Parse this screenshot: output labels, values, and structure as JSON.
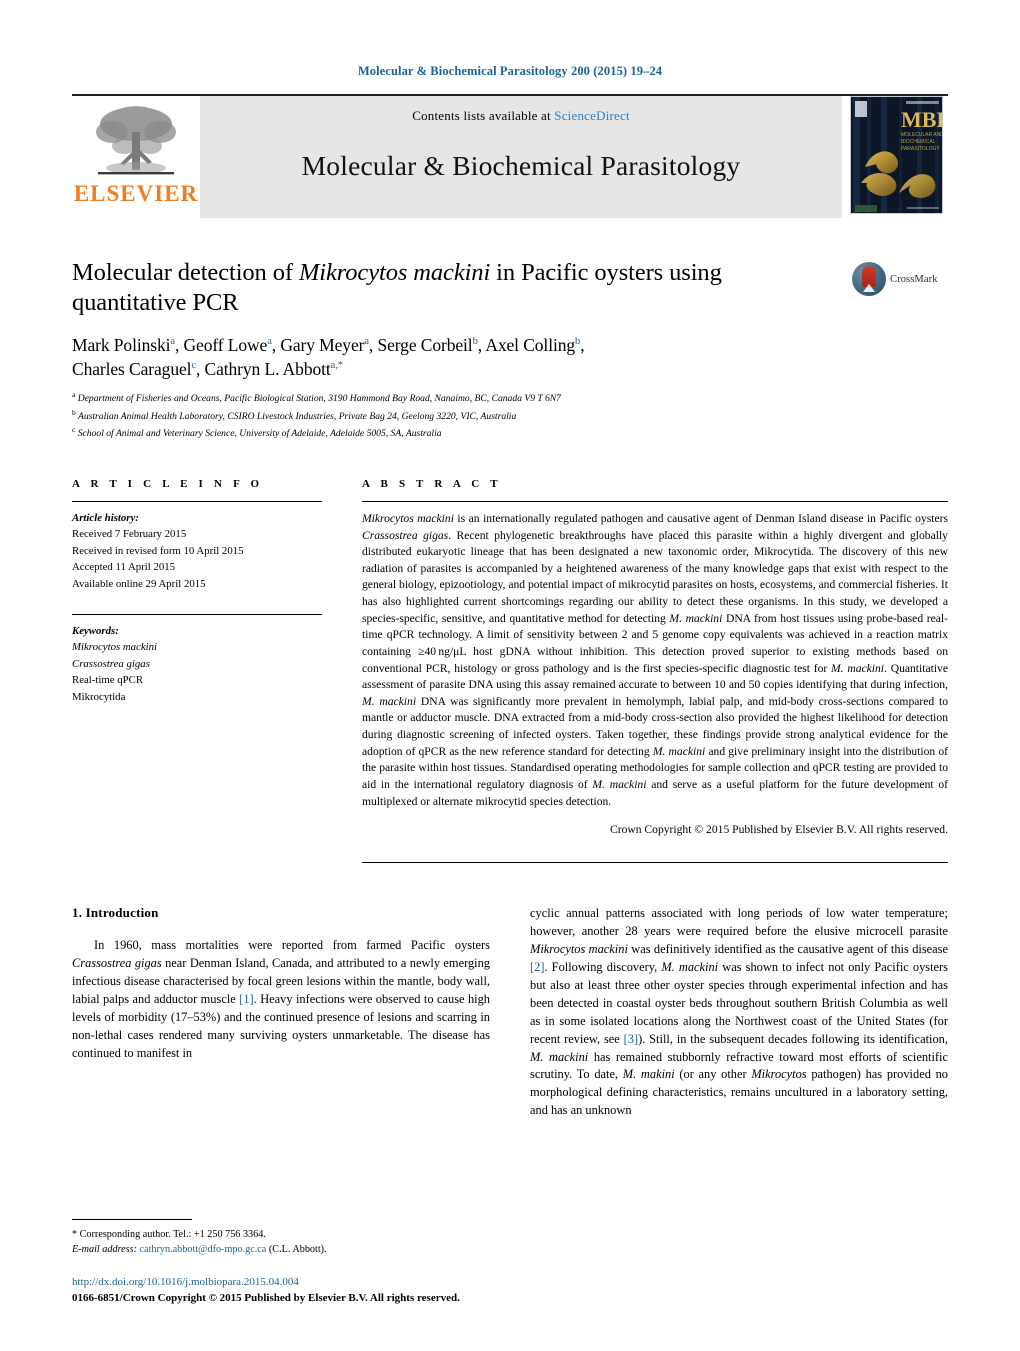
{
  "running_head": "Molecular & Biochemical Parasitology 200 (2015) 19–24",
  "masthead": {
    "publisher_word": "ELSEVIER",
    "contents_prefix": "Contents lists available at ",
    "contents_link": "ScienceDirect",
    "journal_name": "Molecular & Biochemical Parasitology",
    "cover_title": "MBP",
    "cover_subtitle": "MOLECULAR AND BIOCHEMICAL PARASITOLOGY"
  },
  "article": {
    "title_part1": "Molecular detection of ",
    "title_italic": "Mikrocytos mackini",
    "title_part2": " in Pacific oysters using quantitative PCR",
    "crossmark_label": "CrossMark",
    "authors_line1": "Mark Polinski<sup>a</sup>, Geoff Lowe<sup>a</sup>, Gary Meyer<sup>a</sup>, Serge Corbeil<sup>b</sup>, Axel Colling<sup>b</sup>,",
    "authors_line2": "Charles Caraguel<sup>c</sup>, Cathryn L. Abbott<sup>a,</sup><sup>*</sup>",
    "affiliations": [
      {
        "marker": "a",
        "text": "Department of Fisheries and Oceans, Pacific Biological Station, 3190 Hammond Bay Road, Nanaimo, BC, Canada V9 T 6N7"
      },
      {
        "marker": "b",
        "text": "Australian Animal Health Laboratory, CSIRO Livestock Industries, Private Bag 24, Geelong 3220, VIC, Australia"
      },
      {
        "marker": "c",
        "text": "School of Animal and Veterinary Science, University of Adelaide, Adelaide 5005, SA, Australia"
      }
    ]
  },
  "article_info": {
    "heading": "A R T I C L E   I N F O",
    "history_label": "Article history:",
    "history": [
      "Received 7 February 2015",
      "Received in revised form 10 April 2015",
      "Accepted 11 April 2015",
      "Available online 29 April 2015"
    ],
    "keywords_label": "Keywords:",
    "keywords": [
      "Mikrocytos mackini",
      "Crassostrea gigas",
      "Real-time qPCR",
      "Mikrocytida"
    ]
  },
  "abstract": {
    "heading": "A B S T R A C T",
    "text": "<i>Mikrocytos mackini</i> is an internationally regulated pathogen and causative agent of Denman Island disease in Pacific oysters <i>Crassostrea gigas</i>. Recent phylogenetic breakthroughs have placed this parasite within a highly divergent and globally distributed eukaryotic lineage that has been designated a new taxonomic order, Mikrocytida. The discovery of this new radiation of parasites is accompanied by a heightened awareness of the many knowledge gaps that exist with respect to the general biology, epizootiology, and potential impact of mikrocytid parasites on hosts, ecosystems, and commercial fisheries. It has also highlighted current shortcomings regarding our ability to detect these organisms. In this study, we developed a species-specific, sensitive, and quantitative method for detecting <i>M. mackini</i> DNA from host tissues using probe-based real-time qPCR technology. A limit of sensitivity between 2 and 5 genome copy equivalents was achieved in a reaction matrix containing &ge;40&thinsp;ng/&mu;L host gDNA without inhibition. This detection proved superior to existing methods based on conventional PCR, histology or gross pathology and is the first species-specific diagnostic test for <i>M. mackini</i>. Quantitative assessment of parasite DNA using this assay remained accurate to between 10 and 50 copies identifying that during infection, <i>M. mackini</i> DNA was significantly more prevalent in hemolymph, labial palp, and mid-body cross-sections compared to mantle or adductor muscle. DNA extracted from a mid-body cross-section also provided the highest likelihood for detection during diagnostic screening of infected oysters. Taken together, these findings provide strong analytical evidence for the adoption of qPCR as the new reference standard for detecting <i>M. mackini</i> and give preliminary insight into the distribution of the parasite within host tissues. Standardised operating methodologies for sample collection and qPCR testing are provided to aid in the international regulatory diagnosis of <i>M. mackini</i> and serve as a useful platform for the future development of multiplexed or alternate mikrocytid species detection.",
    "copyright": "Crown Copyright © 2015 Published by Elsevier B.V. All rights reserved."
  },
  "body": {
    "section_title": "1.  Introduction",
    "left_paragraph": "In 1960, mass mortalities were reported from farmed Pacific oysters <i>Crassostrea gigas</i> near Denman Island, Canada, and attributed to a newly emerging infectious disease characterised by focal green lesions within the mantle, body wall, labial palps and adductor muscle <span class=\"ref\">[1]</span>. Heavy infections were observed to cause high levels of morbidity (17–53%) and the continued presence of lesions and scarring in non-lethal cases rendered many surviving oysters unmarketable. The disease has continued to manifest in",
    "right_paragraph": "cyclic annual patterns associated with long periods of low water temperature; however, another 28 years were required before the elusive microcell parasite <i>Mikrocytos mackini</i> was definitively identified as the causative agent of this disease <span class=\"ref\">[2]</span>. Following discovery, <i>M. mackini</i> was shown to infect not only Pacific oysters but also at least three other oyster species through experimental infection and has been detected in coastal oyster beds throughout southern British Columbia as well as in some isolated locations along the Northwest coast of the United States (for recent review, see <span class=\"ref\">[3]</span>). Still, in the subsequent decades following its identification, <i>M. mackini</i> has remained stubbornly refractive toward most efforts of scientific scrutiny. To date, <i>M. makini</i> (or any other <i>Mikrocytos</i> pathogen) has provided no morphological defining characteristics, remains uncultured in a laboratory setting, and has an unknown"
  },
  "footnote": {
    "corresponding": "*  Corresponding author. Tel.: +1 250 756 3364.",
    "email_label": "E-mail address:",
    "email": "cathryn.abbott@dfo-mpo.gc.ca",
    "email_suffix": " (C.L. Abbott).",
    "doi": "http://dx.doi.org/10.1016/j.molbiopara.2015.04.004",
    "issn_line": "0166-6851/Crown Copyright © 2015 Published by Elsevier B.V. All rights reserved."
  },
  "colors": {
    "link": "#1a6496",
    "elsevier_orange": "#ef7d22",
    "sciencedirect_blue": "#2e7fc1",
    "masthead_gray": "#e6e6e6"
  }
}
